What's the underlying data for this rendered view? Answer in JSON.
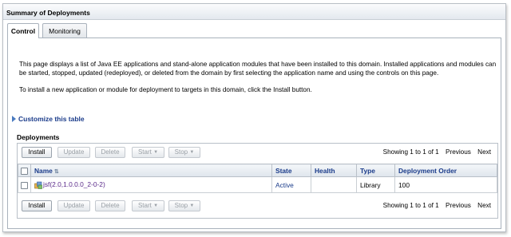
{
  "window": {
    "title": "Summary of Deployments"
  },
  "tabs": [
    {
      "label": "Control",
      "active": true
    },
    {
      "label": "Monitoring",
      "active": false
    }
  ],
  "description": {
    "para1": "This page displays a list of Java EE applications and stand-alone application modules that have been installed to this domain. Installed applications and modules can be started, stopped, updated (redeployed), or deleted from the domain by first selecting the application name and using the controls on this page.",
    "para2": "To install a new application or module for deployment to targets in this domain, click the Install button."
  },
  "customize_label": "Customize this table",
  "deployments_title": "Deployments",
  "toolbar": {
    "install": "Install",
    "update": "Update",
    "delete": "Delete",
    "start": "Start",
    "stop": "Stop",
    "pager_text": "Showing 1 to 1 of 1",
    "previous": "Previous",
    "next": "Next"
  },
  "table": {
    "columns": [
      "Name",
      "State",
      "Health",
      "Type",
      "Deployment Order"
    ],
    "rows": [
      {
        "name": "jsf(2.0,1.0.0.0_2-0-2)",
        "state": "Active",
        "health": "",
        "type": "Library",
        "order": "100"
      }
    ]
  },
  "colors": {
    "link": "#1a3b8a",
    "visited_link": "#5a2a8a",
    "header_bg": "#dfe5ec"
  }
}
